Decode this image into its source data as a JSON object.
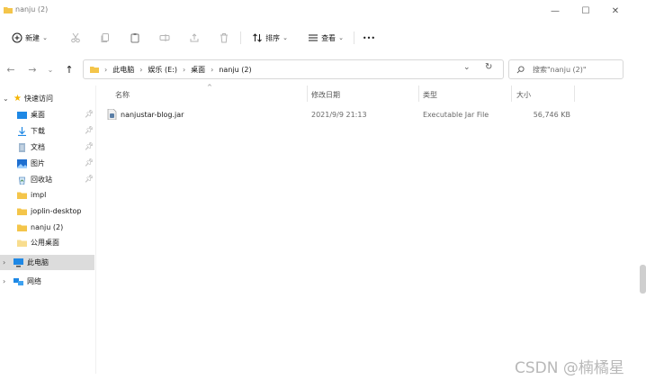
{
  "window": {
    "title": "nanju (2)",
    "controls": {
      "minimize": "—",
      "maximize": "☐",
      "close": "✕"
    }
  },
  "toolbar": {
    "new_label": "新建",
    "sort_label": "排序",
    "view_label": "查看",
    "more_label": "•••",
    "icons": [
      "cut-icon",
      "copy-icon",
      "paste-icon",
      "rename-icon",
      "share-icon",
      "delete-icon"
    ]
  },
  "address": {
    "breadcrumbs": [
      "此电脑",
      "娱乐 (E:)",
      "桌面",
      "nanju (2)"
    ],
    "search_placeholder": "搜索\"nanju (2)\""
  },
  "columns": [
    "名称",
    "修改日期",
    "类型",
    "大小"
  ],
  "sidebar": {
    "quick_access_label": "快速访问",
    "items": [
      {
        "label": "桌面",
        "icon": "desktop-icon",
        "pinned": true
      },
      {
        "label": "下载",
        "icon": "download-icon",
        "pinned": true
      },
      {
        "label": "文档",
        "icon": "document-icon",
        "pinned": true
      },
      {
        "label": "图片",
        "icon": "picture-icon",
        "pinned": true
      },
      {
        "label": "回收站",
        "icon": "recycle-bin-icon",
        "pinned": true
      },
      {
        "label": "impl",
        "icon": "folder-icon",
        "pinned": false
      },
      {
        "label": "joplin-desktop",
        "icon": "folder-icon",
        "pinned": false
      },
      {
        "label": "nanju (2)",
        "icon": "folder-icon",
        "pinned": false
      },
      {
        "label": "公用桌面",
        "icon": "folder-icon",
        "pinned": false
      }
    ],
    "this_pc_label": "此电脑",
    "network_label": "网络"
  },
  "files": [
    {
      "name": "nanjustar-blog.jar",
      "modified": "2021/9/9 21:13",
      "type": "Executable Jar File",
      "size": "56,746 KB"
    }
  ],
  "watermark": "CSDN @楠橘星",
  "colors": {
    "accent": "#0067c0",
    "folder": "#f4c54a",
    "selected": "#dcdcdc"
  }
}
